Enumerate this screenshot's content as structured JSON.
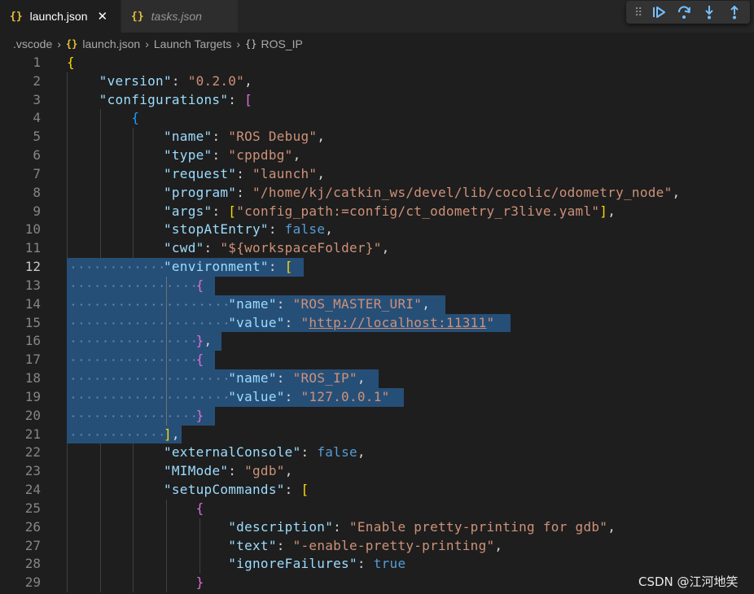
{
  "tabs": [
    {
      "icon": "{}",
      "label": "launch.json",
      "close": "✕"
    },
    {
      "icon": "{}",
      "label": "tasks.json"
    }
  ],
  "debug_toolbar": [
    "drag-grip",
    "continue",
    "step-over",
    "step-into",
    "step-out"
  ],
  "breadcrumb": {
    "root": ".vscode",
    "file_icon": "{}",
    "file": "launch.json",
    "section": "Launch Targets",
    "object_icon": "{}",
    "item": "ROS_IP"
  },
  "editor": {
    "current_line": 12,
    "lines": [
      {
        "n": "1",
        "t": [
          [
            "y",
            "{"
          ]
        ]
      },
      {
        "n": "2",
        "t": [
          [
            "k",
            "\"version\""
          ],
          [
            "p",
            ": "
          ],
          [
            "s",
            "\"0.2.0\""
          ],
          [
            "p",
            ","
          ]
        ]
      },
      {
        "n": "3",
        "t": [
          [
            "k",
            "\"configurations\""
          ],
          [
            "p",
            ": "
          ],
          [
            "m",
            "["
          ]
        ]
      },
      {
        "n": "4",
        "t": [
          [
            "bl",
            "{"
          ]
        ]
      },
      {
        "n": "5",
        "t": [
          [
            "k",
            "\"name\""
          ],
          [
            "p",
            ": "
          ],
          [
            "s",
            "\"ROS Debug\""
          ],
          [
            "p",
            ","
          ]
        ]
      },
      {
        "n": "6",
        "t": [
          [
            "k",
            "\"type\""
          ],
          [
            "p",
            ": "
          ],
          [
            "s",
            "\"cppdbg\""
          ],
          [
            "p",
            ","
          ]
        ]
      },
      {
        "n": "7",
        "t": [
          [
            "k",
            "\"request\""
          ],
          [
            "p",
            ": "
          ],
          [
            "s",
            "\"launch\""
          ],
          [
            "p",
            ","
          ]
        ]
      },
      {
        "n": "8",
        "t": [
          [
            "k",
            "\"program\""
          ],
          [
            "p",
            ": "
          ],
          [
            "s",
            "\"/home/kj/catkin_ws/devel/lib/cocolic/odometry_node\""
          ],
          [
            "p",
            ","
          ]
        ]
      },
      {
        "n": "9",
        "t": [
          [
            "k",
            "\"args\""
          ],
          [
            "p",
            ": "
          ],
          [
            "y",
            "["
          ],
          [
            "s",
            "\"config_path:=config/ct_odometry_r3live.yaml\""
          ],
          [
            "y",
            "]"
          ],
          [
            "p",
            ","
          ]
        ]
      },
      {
        "n": "10",
        "t": [
          [
            "k",
            "\"stopAtEntry\""
          ],
          [
            "p",
            ": "
          ],
          [
            "b",
            "false"
          ],
          [
            "p",
            ","
          ]
        ]
      },
      {
        "n": "11",
        "t": [
          [
            "k",
            "\"cwd\""
          ],
          [
            "p",
            ": "
          ],
          [
            "s",
            "\"${workspaceFolder}\""
          ],
          [
            "p",
            ","
          ]
        ]
      },
      {
        "n": "12",
        "t": [
          [
            "k",
            "\"environment\""
          ],
          [
            "p",
            ": "
          ],
          [
            "y",
            "["
          ]
        ]
      },
      {
        "n": "13",
        "t": [
          [
            "m",
            "{"
          ]
        ]
      },
      {
        "n": "14",
        "t": [
          [
            "k",
            "\"name\""
          ],
          [
            "p",
            ": "
          ],
          [
            "s",
            "\"ROS_MASTER_URI\""
          ],
          [
            "p",
            ","
          ]
        ]
      },
      {
        "n": "15",
        "t": [
          [
            "k",
            "\"value\""
          ],
          [
            "p",
            ": "
          ],
          [
            "s",
            "\""
          ],
          [
            "u",
            "http://localhost:11311"
          ],
          [
            "s",
            "\""
          ]
        ]
      },
      {
        "n": "16",
        "t": [
          [
            "m",
            "}"
          ],
          [
            "p",
            ","
          ]
        ]
      },
      {
        "n": "17",
        "t": [
          [
            "m",
            "{"
          ]
        ]
      },
      {
        "n": "18",
        "t": [
          [
            "k",
            "\"name\""
          ],
          [
            "p",
            ": "
          ],
          [
            "s",
            "\"ROS_IP\""
          ],
          [
            "p",
            ","
          ]
        ]
      },
      {
        "n": "19",
        "t": [
          [
            "k",
            "\"value\""
          ],
          [
            "p",
            ": "
          ],
          [
            "s",
            "\"127.0.0.1\""
          ]
        ]
      },
      {
        "n": "20",
        "t": [
          [
            "m",
            "}"
          ]
        ]
      },
      {
        "n": "21",
        "t": [
          [
            "y",
            "]"
          ],
          [
            "p",
            ","
          ]
        ]
      },
      {
        "n": "22",
        "t": [
          [
            "k",
            "\"externalConsole\""
          ],
          [
            "p",
            ": "
          ],
          [
            "b",
            "false"
          ],
          [
            "p",
            ","
          ]
        ]
      },
      {
        "n": "23",
        "t": [
          [
            "k",
            "\"MIMode\""
          ],
          [
            "p",
            ": "
          ],
          [
            "s",
            "\"gdb\""
          ],
          [
            "p",
            ","
          ]
        ]
      },
      {
        "n": "24",
        "t": [
          [
            "k",
            "\"setupCommands\""
          ],
          [
            "p",
            ": "
          ],
          [
            "y",
            "["
          ]
        ]
      },
      {
        "n": "25",
        "t": [
          [
            "m",
            "{"
          ]
        ]
      },
      {
        "n": "26",
        "t": [
          [
            "k",
            "\"description\""
          ],
          [
            "p",
            ": "
          ],
          [
            "s",
            "\"Enable pretty-printing for gdb\""
          ],
          [
            "p",
            ","
          ]
        ]
      },
      {
        "n": "27",
        "t": [
          [
            "k",
            "\"text\""
          ],
          [
            "p",
            ": "
          ],
          [
            "s",
            "\"-enable-pretty-printing\""
          ],
          [
            "p",
            ","
          ]
        ]
      },
      {
        "n": "28",
        "t": [
          [
            "k",
            "\"ignoreFailures\""
          ],
          [
            "p",
            ": "
          ],
          [
            "b",
            "true"
          ]
        ]
      },
      {
        "n": "29",
        "t": [
          [
            "m",
            "}"
          ]
        ]
      }
    ]
  },
  "watermark": "CSDN @江河地笑"
}
